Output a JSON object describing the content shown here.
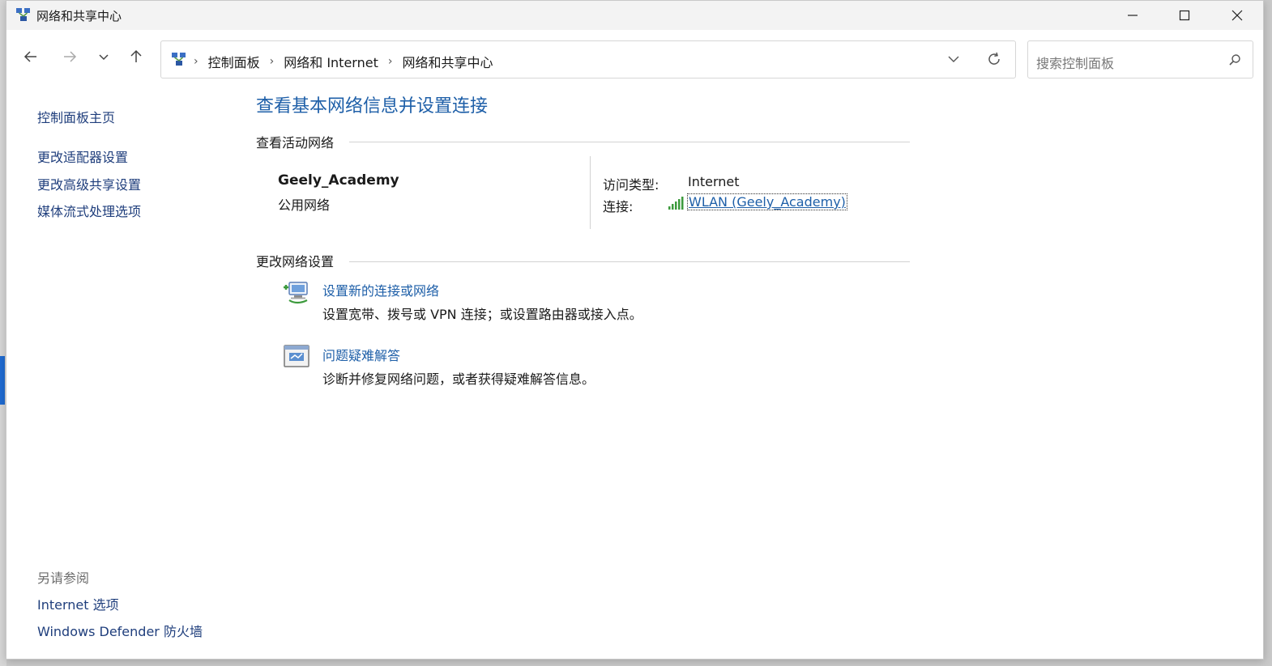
{
  "window": {
    "title": "网络和共享中心",
    "controls": {
      "minimize": "minimize",
      "maximize": "maximize",
      "close": "close"
    }
  },
  "nav": {
    "breadcrumbs": [
      "控制面板",
      "网络和 Internet",
      "网络和共享中心"
    ],
    "search_placeholder": "搜索控制面板"
  },
  "sidebar": {
    "home": "控制面板主页",
    "links": [
      "更改适配器设置",
      "更改高级共享设置",
      "媒体流式处理选项"
    ],
    "see_also_title": "另请参阅",
    "see_also": [
      "Internet 选项",
      "Windows Defender 防火墙"
    ]
  },
  "main": {
    "heading": "查看基本网络信息并设置连接",
    "active_section": "查看活动网络",
    "network": {
      "name": "Geely_Academy",
      "type": "公用网络",
      "access_label": "访问类型:",
      "access_value": "Internet",
      "conn_label": "连接:",
      "conn_value": "WLAN (Geely_Academy)"
    },
    "change_section": "更改网络设置",
    "tasks": [
      {
        "title": "设置新的连接或网络",
        "desc": "设置宽带、拨号或 VPN 连接；或设置路由器或接入点。",
        "icon": "network-setup-icon"
      },
      {
        "title": "问题疑难解答",
        "desc": "诊断并修复网络问题，或者获得疑难解答信息。",
        "icon": "troubleshoot-icon"
      }
    ]
  },
  "colors": {
    "link": "#1e5fa8",
    "sidebar_link": "#1f3e7c",
    "titlebar": "#f3f3f3",
    "signal": "#3c9a3c"
  }
}
